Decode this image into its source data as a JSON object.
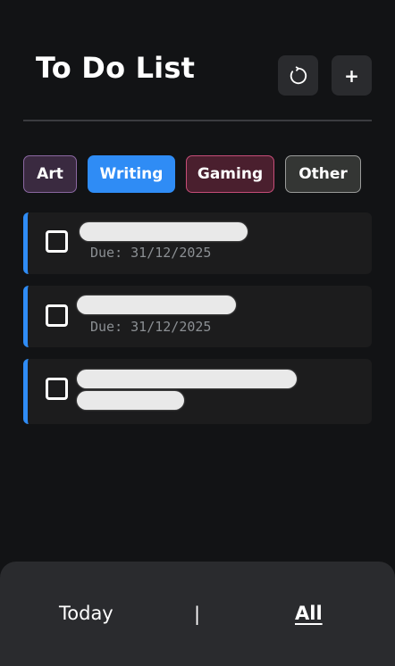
{
  "header": {
    "title": "To Do List",
    "refresh_icon": "refresh-icon",
    "add_label": "+"
  },
  "categories": [
    {
      "label": "Art",
      "color": "#3a2a40",
      "border": "#8a67a1"
    },
    {
      "label": "Writing",
      "color": "#2f8cf5",
      "border": "#2f8cf5",
      "selected": true
    },
    {
      "label": "Gaming",
      "color": "#4a1f2e",
      "border": "#c64d78"
    },
    {
      "label": "Other",
      "color": "#343634",
      "border": "#9a9b9a"
    }
  ],
  "tasks": [
    {
      "title": "",
      "due": "Due: 31/12/2025",
      "accent": "#2f8cf5"
    },
    {
      "title": "",
      "due": "Due: 31/12/2025",
      "accent": "#2f8cf5"
    },
    {
      "title": "",
      "due": "",
      "accent": "#2f8cf5"
    }
  ],
  "bottom_nav": {
    "today": "Today",
    "separator": "|",
    "all": "All",
    "active": "All"
  },
  "colors": {
    "background": "#121315",
    "card": "#1c1c1d",
    "nav": "#2a2b2e",
    "accent": "#2f8cf5",
    "muted_text": "#8b8f93"
  }
}
